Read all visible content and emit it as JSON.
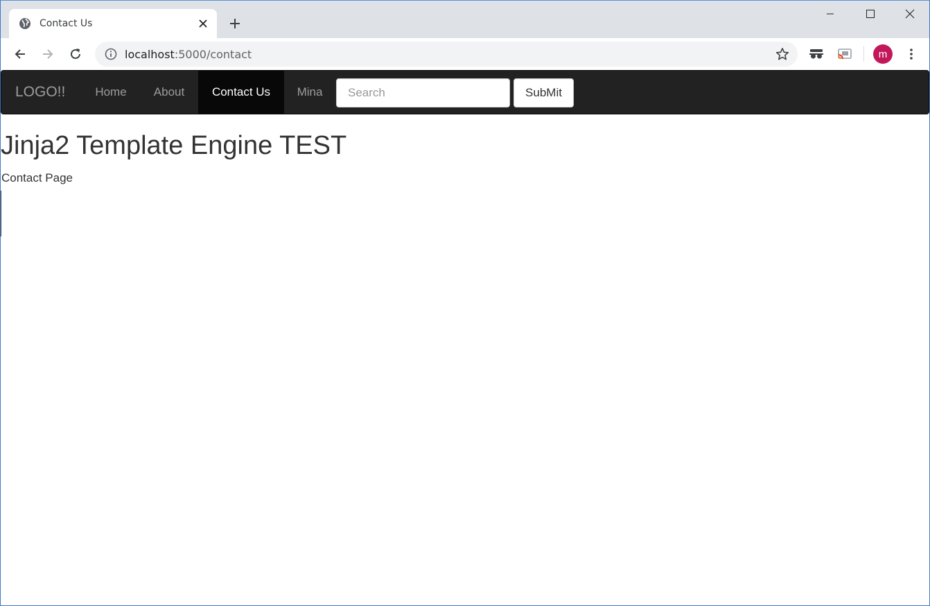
{
  "browser": {
    "tab_title": "Contact Us",
    "url_host": "localhost",
    "url_path": ":5000/contact",
    "profile_initial": "m",
    "icons": {
      "favicon": "globe-icon",
      "tab_close": "close-icon",
      "new_tab": "plus-icon",
      "minimize": "minimize-icon",
      "maximize": "maximize-icon",
      "close": "close-icon",
      "back": "arrow-left-icon",
      "forward": "arrow-right-icon",
      "reload": "reload-icon",
      "site_info": "info-icon",
      "bookmark": "star-icon",
      "extension_1": "incognito-mask-icon",
      "extension_2": "cast-icon",
      "menu": "kebab-menu-icon"
    },
    "colors": {
      "tabstrip": "#dee1e6",
      "omnibox": "#f1f3f4",
      "avatar": "#c2185b"
    }
  },
  "site": {
    "navbar": {
      "brand": "LOGO!!",
      "links": [
        {
          "label": "Home",
          "active": false
        },
        {
          "label": "About",
          "active": false
        },
        {
          "label": "Contact Us",
          "active": true
        },
        {
          "label": "Mina",
          "active": false
        }
      ],
      "search_placeholder": "Search",
      "submit_label": "SubMit",
      "colors": {
        "background": "#222222",
        "active_background": "#080808",
        "link": "#9d9d9d",
        "active_link": "#ffffff"
      }
    },
    "heading": "Jinja2 Template Engine TEST",
    "subtext": "Contact Page"
  }
}
